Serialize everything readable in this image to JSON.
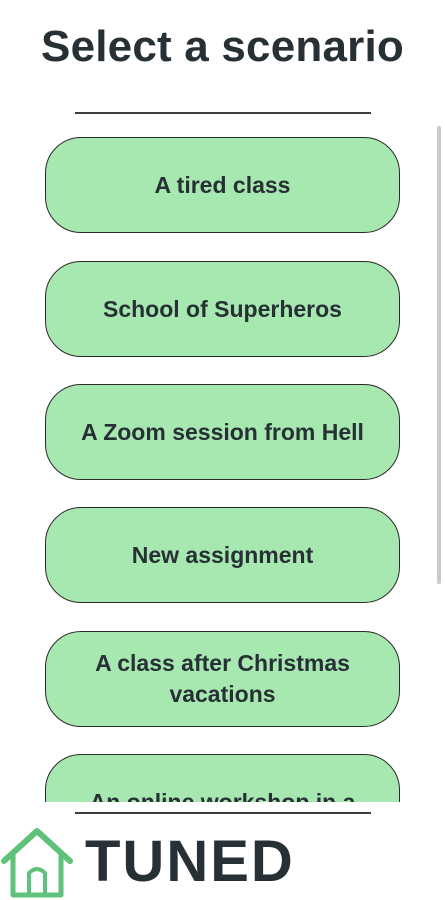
{
  "header": {
    "title": "Select a scenario"
  },
  "scenarios": [
    {
      "label": "A tired class"
    },
    {
      "label": "School of Superheros"
    },
    {
      "label": "A Zoom session from Hell"
    },
    {
      "label": "New assignment"
    },
    {
      "label": "A class after Christmas vacations"
    },
    {
      "label": "An online workshop in a"
    }
  ],
  "footer": {
    "brand": "TUNED",
    "logo_icon": "house-icon"
  },
  "colors": {
    "button_fill": "#a7e8b1",
    "button_border": "#2a2a2a",
    "text": "#263035",
    "logo_house_green": "#5ec27a"
  }
}
